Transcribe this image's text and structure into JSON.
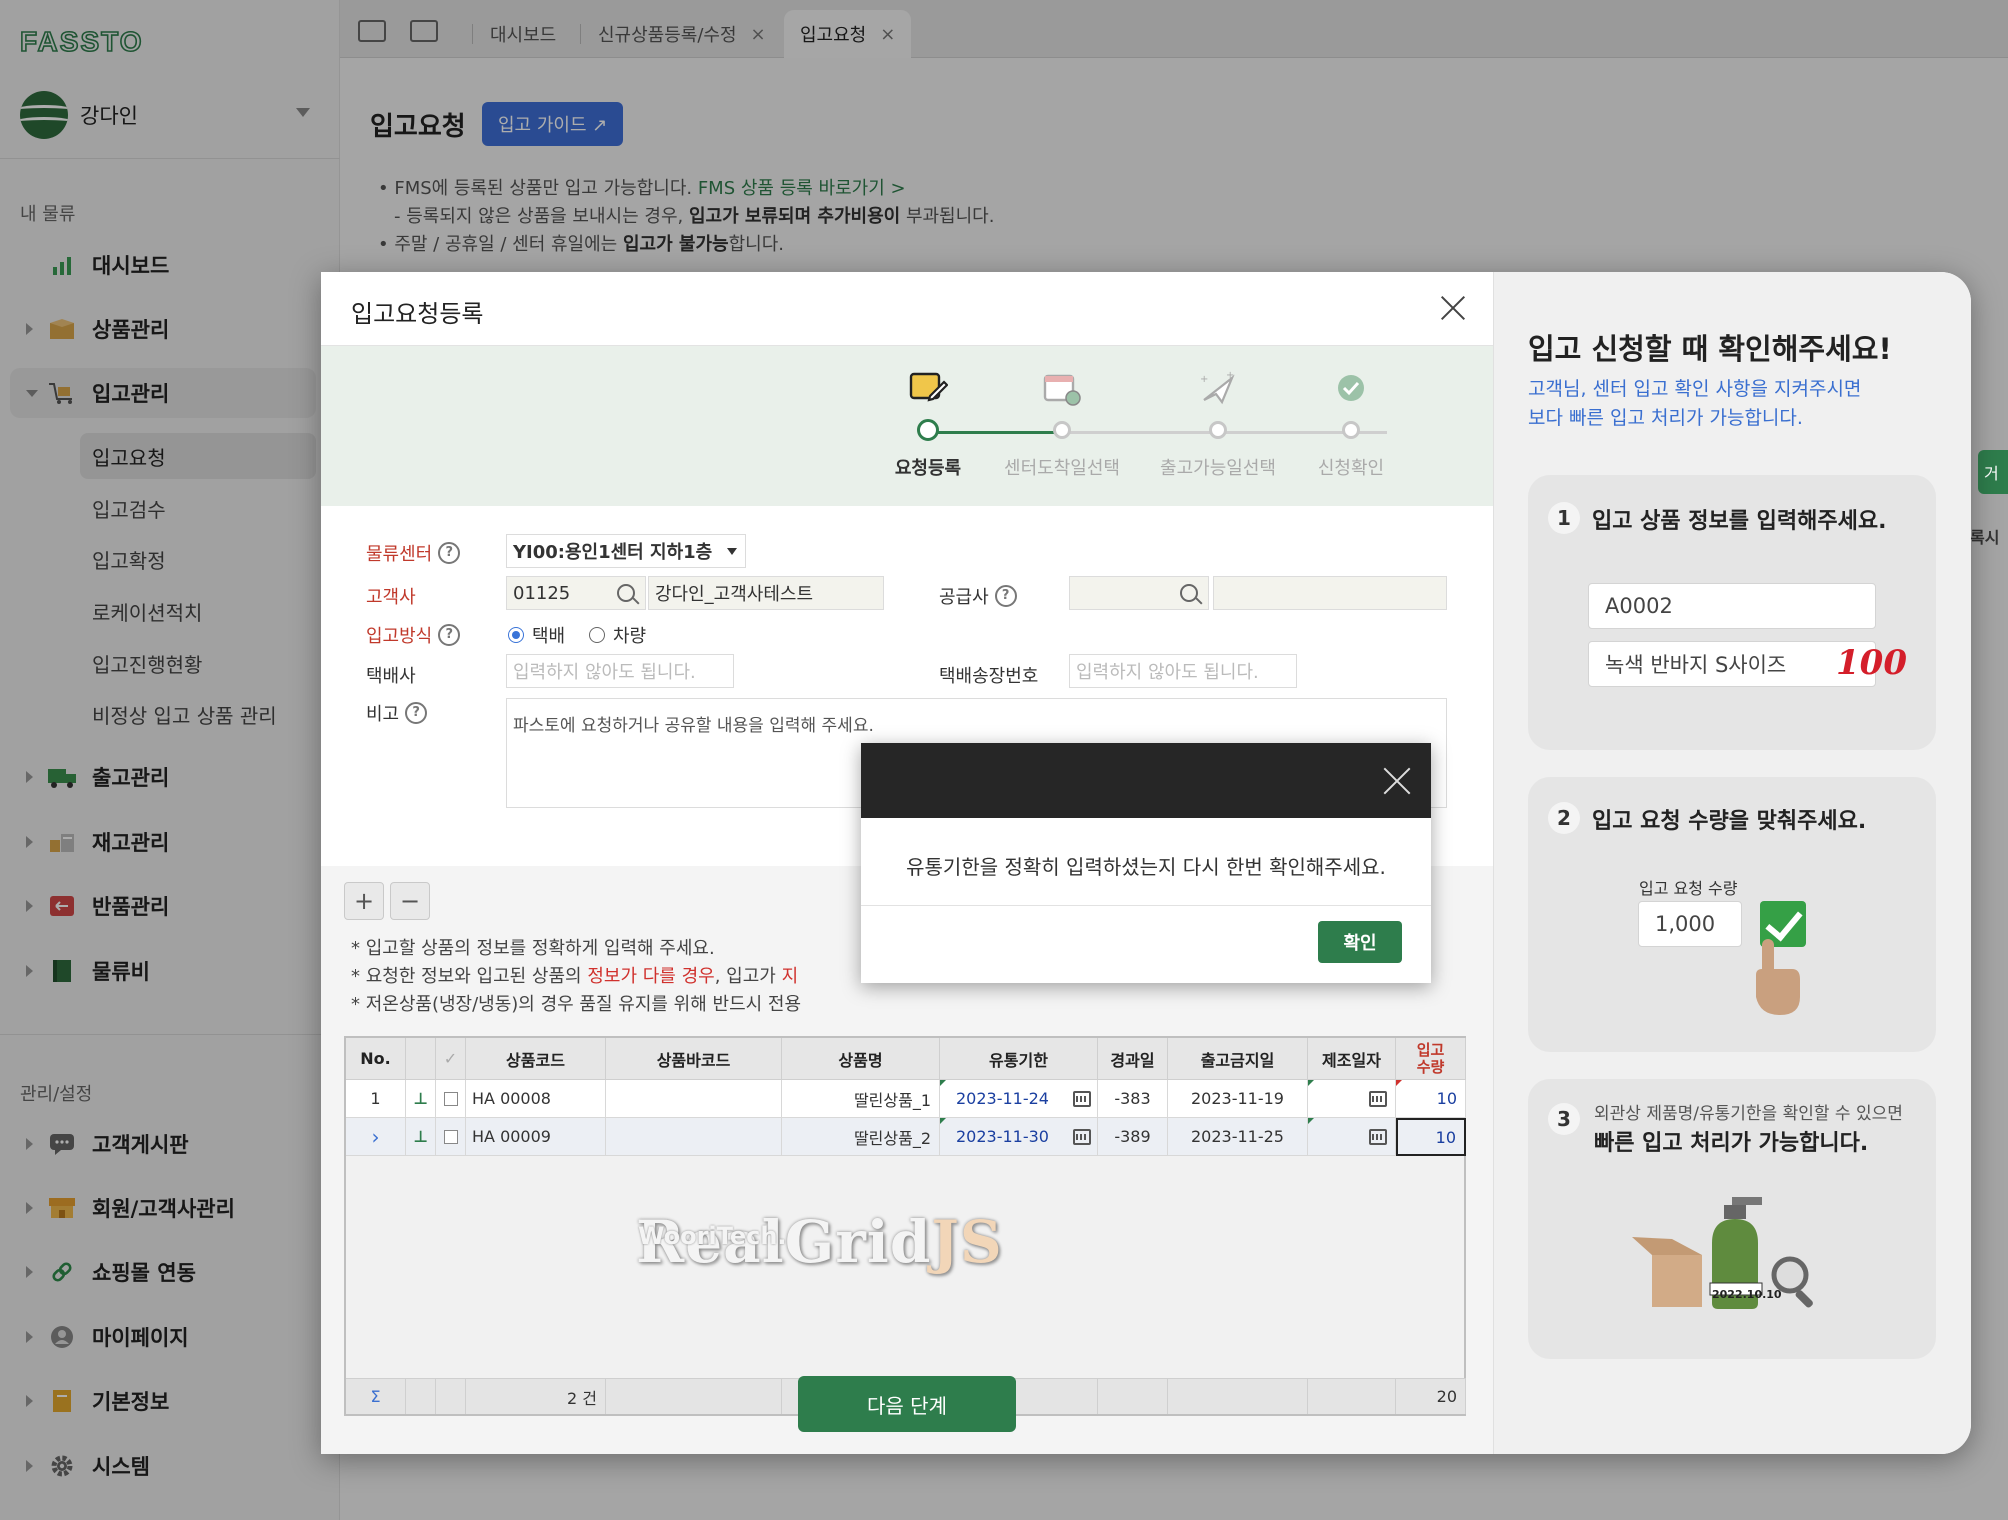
{
  "brand": {
    "logo_text": "FASSTO",
    "accent": "#2e7d4c",
    "link_blue": "#3f6fd8"
  },
  "user": {
    "name": "강다인"
  },
  "sidebar": {
    "section_my": "내 물류",
    "section_admin": "관리/설정",
    "items": [
      {
        "label": "대시보드",
        "icon": "bar-chart-icon"
      },
      {
        "label": "상품관리",
        "icon": "box-icon"
      },
      {
        "label": "입고관리",
        "icon": "cart-icon"
      },
      {
        "label": "출고관리",
        "icon": "truck-icon"
      },
      {
        "label": "재고관리",
        "icon": "inventory-icon"
      },
      {
        "label": "반품관리",
        "icon": "return-icon"
      },
      {
        "label": "물류비",
        "icon": "ledger-icon"
      }
    ],
    "sub_items": [
      "입고요청",
      "입고검수",
      "입고확정",
      "로케이션적치",
      "입고진행현황",
      "비정상 입고 상품 관리"
    ],
    "admin_items": [
      {
        "label": "고객게시판",
        "icon": "chat-icon"
      },
      {
        "label": "회원/고객사관리",
        "icon": "store-icon"
      },
      {
        "label": "쇼핑몰 연동",
        "icon": "link-icon"
      },
      {
        "label": "마이페이지",
        "icon": "person-icon"
      },
      {
        "label": "기본정보",
        "icon": "notebook-icon"
      },
      {
        "label": "시스템",
        "icon": "gear-icon"
      }
    ]
  },
  "tabs": [
    {
      "label": "대시보드"
    },
    {
      "label": "신규상품등록/수정",
      "close": "×"
    },
    {
      "label": "입고요청",
      "close": "×"
    }
  ],
  "page": {
    "title": "입고요청",
    "guide_button": "입고 가이드 ↗",
    "notice1_prefix": "• FMS에 등록된 상품만 입고 가능합니다. ",
    "notice1_link": "FMS 상품 등록 바로가기 >",
    "notice2_a": "- 등록되지 않은 상품을 보내시는 경우, ",
    "notice2_b": "입고가 보류되며 추가비용이",
    "notice2_c": " 부과됩니다.",
    "notice3_a": "• 주말 / 공휴일 / 센터 휴일에는 ",
    "notice3_b": "입고가 불가능",
    "notice3_c": "합니다."
  },
  "modal": {
    "title": "입고요청등록",
    "steps": [
      "요청등록",
      "센터도착일선택",
      "출고가능일선택",
      "신청확인"
    ],
    "form": {
      "center_label": "물류센터",
      "center_value": "YI00:용인1센터 지하1층",
      "customer_label": "고객사",
      "customer_code": "01125",
      "customer_name": "강다인_고객사테스트",
      "supplier_label": "공급사",
      "method_label": "입고방식",
      "method_options": [
        "택배",
        "차량"
      ],
      "courier_label": "택배사",
      "courier_placeholder": "입력하지 않아도 됩니다.",
      "tracking_label": "택배송장번호",
      "tracking_placeholder": "입력하지 않아도 됩니다.",
      "memo_label": "비고",
      "memo_placeholder": "파스토에 요청하거나 공유할 내용을 입력해 주세요."
    },
    "grid_notes": {
      "n1": "* 입고할 상품의 정보를 정확하게 입력해 주세요.",
      "n2_a": "* 요청한 정보와 입고된 상품의 ",
      "n2_red": "정보가 다를 경우",
      "n2_b": ", 입고가 ",
      "n2_red2": "지",
      "n3": "* 저온상품(냉장/냉동)의 경우 품질 유지를 위해 반드시 전용"
    },
    "grid": {
      "headers": [
        "No.",
        "",
        "✓",
        "상품코드",
        "상품바코드",
        "상품명",
        "유통기한",
        "경과일",
        "출고금지일",
        "제조일자",
        "입고 수량"
      ],
      "rows": [
        {
          "no": "1",
          "code": "HA 00008",
          "barcode": "",
          "name": "딸린상품_1",
          "expiry": "2023-11-24",
          "elapsed": "-383",
          "ship_ban": "2023-11-19",
          "mfg": "",
          "qty": "10"
        },
        {
          "no": "›",
          "code": "HA 00009",
          "barcode": "",
          "name": "딸린상품_2",
          "expiry": "2023-11-30",
          "elapsed": "-389",
          "ship_ban": "2023-11-25",
          "mfg": "",
          "qty": "10"
        }
      ],
      "footer_sigma": "Σ",
      "footer_count": "2 건",
      "footer_total": "20",
      "watermark_brand": "WooriTech.",
      "watermark_main": "RealGrid",
      "watermark_js": "JS"
    },
    "next_button": "다음 단계"
  },
  "info_panel": {
    "title": "입고 신청할 때 확인해주세요!",
    "subtitle1": "고객님, 센터 입고 확인 사항을 지켜주시면",
    "subtitle2": "보다 빠른 입고 처리가 가능합니다.",
    "card1_num": "1",
    "card1_text": "입고 상품 정보를 입력해주세요.",
    "card1_code": "A0002",
    "card1_name": "녹색 반바지 S사이즈",
    "card1_badge": "100",
    "card2_num": "2",
    "card2_text": "입고 요청 수량을 맞춰주세요.",
    "card2_label": "입고 요청 수량",
    "card2_value": "1,000",
    "card3_num": "3",
    "card3_small": "외관상 제품명/유통기한을 확인할 수 있으면",
    "card3_text": "빠른 입고 처리가 가능합니다.",
    "card3_date": "2022.10.10"
  },
  "edge": {
    "tag": "거",
    "text": "록시"
  },
  "alert": {
    "message": "유통기한을 정확히 입력하셨는지 다시 한번 확인해주세요.",
    "ok": "확인"
  }
}
